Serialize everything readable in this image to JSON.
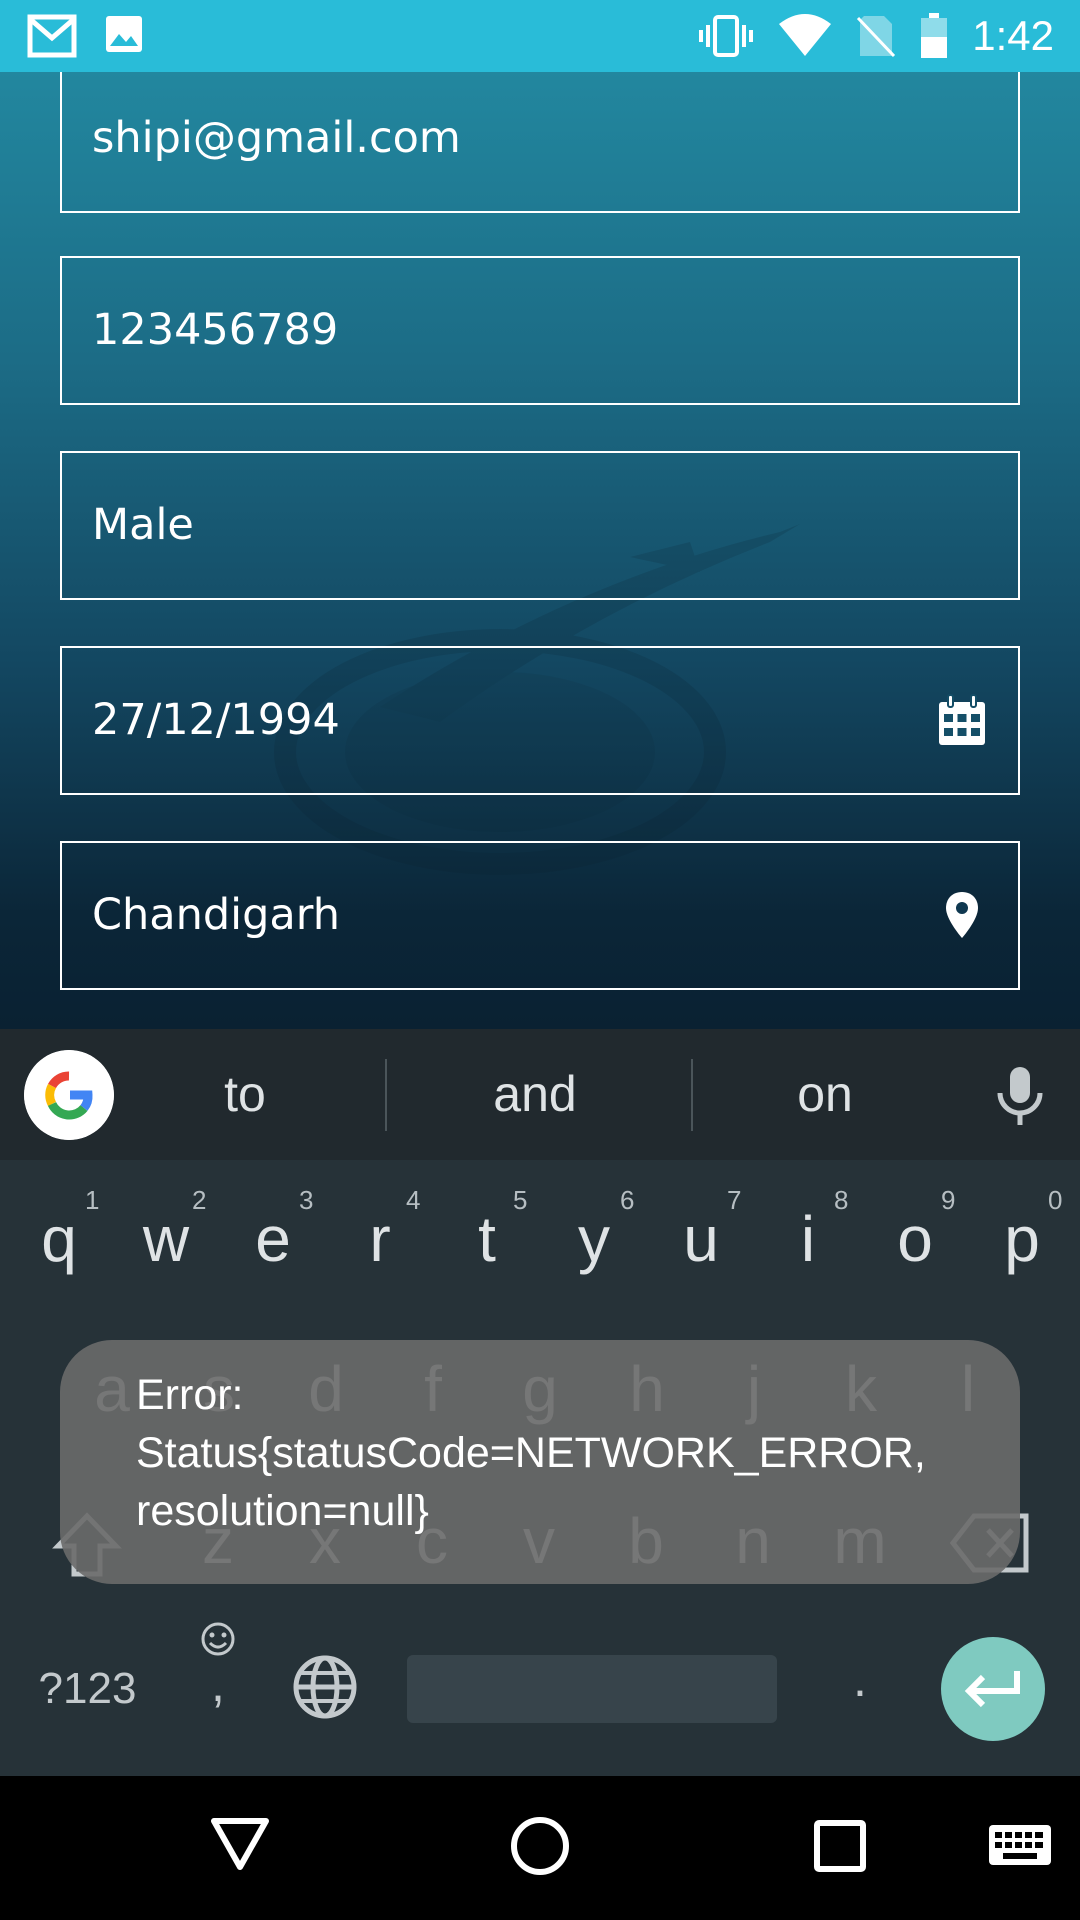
{
  "status_bar": {
    "time": "1:42",
    "left_icons": [
      "gmail-icon",
      "image-icon"
    ],
    "right_icons": [
      "vibrate-icon",
      "wifi-icon",
      "no-sim-icon",
      "battery-icon"
    ]
  },
  "form": {
    "email": "shipi@gmail.com",
    "phone": "123456789",
    "gender": "Male",
    "dob": "27/12/1994",
    "city": "Chandigarh"
  },
  "keyboard": {
    "suggestions": [
      "to",
      "and",
      "on"
    ],
    "row1": [
      "q",
      "w",
      "e",
      "r",
      "t",
      "y",
      "u",
      "i",
      "o",
      "p"
    ],
    "row1_hints": [
      "1",
      "2",
      "3",
      "4",
      "5",
      "6",
      "7",
      "8",
      "9",
      "0"
    ],
    "row2": [
      "a",
      "s",
      "d",
      "f",
      "g",
      "h",
      "j",
      "k",
      "l"
    ],
    "row3": [
      "z",
      "x",
      "c",
      "v",
      "b",
      "n",
      "m"
    ],
    "symbols_label": "?123",
    "comma": ",",
    "period": "."
  },
  "toast": {
    "line1": "Error:",
    "line2": "Status{statusCode=NETWORK_ERROR,",
    "line3": "resolution=null}"
  },
  "colors": {
    "status_bar": "#29bcd8",
    "keyboard_bg": "#263238",
    "enter_key": "#7fcac0"
  }
}
